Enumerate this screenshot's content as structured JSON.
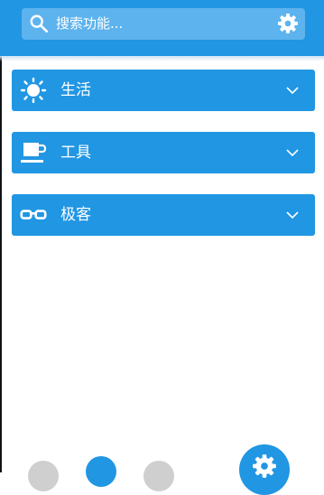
{
  "search": {
    "placeholder": "搜索功能..."
  },
  "categories": [
    {
      "label": "生活",
      "icon": "sun-icon"
    },
    {
      "label": "工具",
      "icon": "cup-icon"
    },
    {
      "label": "极客",
      "icon": "glasses-icon"
    }
  ],
  "colors": {
    "primary": "#2196e3",
    "search_field": "#5db3ee",
    "text": "#ffffff"
  }
}
